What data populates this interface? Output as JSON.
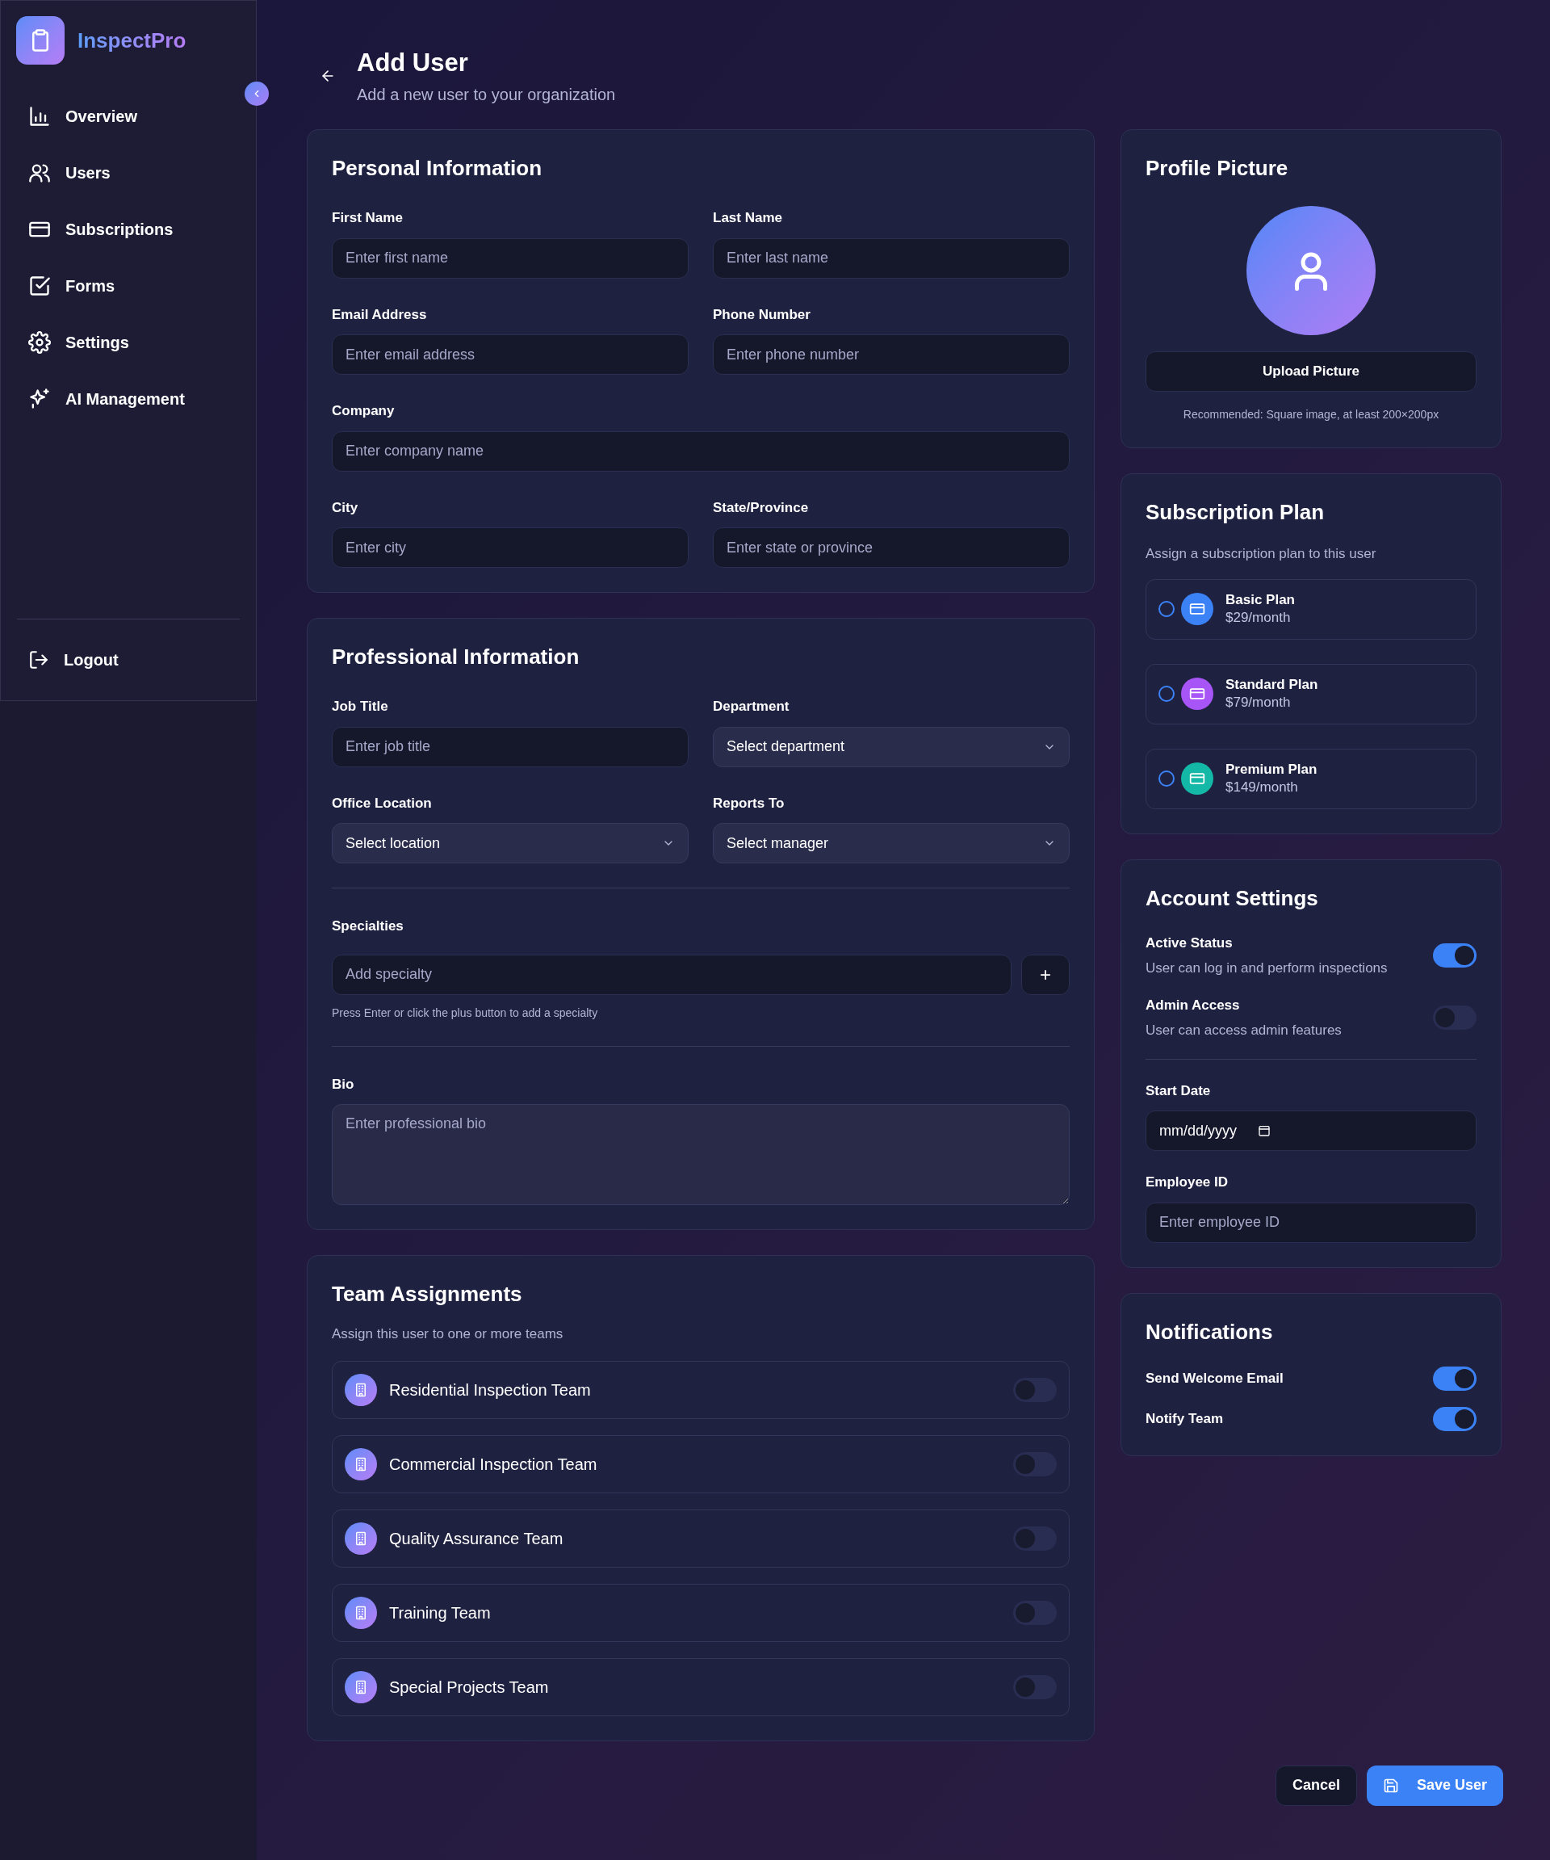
{
  "sidebar": {
    "brand": "InspectPro",
    "items": [
      {
        "label": "Overview",
        "selected": false
      },
      {
        "label": "Users",
        "selected": false
      },
      {
        "label": "Subscriptions",
        "selected": false
      },
      {
        "label": "Forms",
        "selected": false
      },
      {
        "label": "Settings",
        "selected": false
      },
      {
        "label": "AI Management",
        "selected": false
      }
    ],
    "logout": "Logout"
  },
  "header": {
    "title": "Add User",
    "subtitle": "Add a new user to your organization"
  },
  "personal": {
    "title": "Personal Information",
    "fields": [
      {
        "label": "First Name",
        "placeholder": "Enter first name",
        "kind": "input"
      },
      {
        "label": "Last Name",
        "placeholder": "Enter last name",
        "kind": "input"
      },
      {
        "label": "Email Address",
        "placeholder": "Enter email address",
        "kind": "input"
      },
      {
        "label": "Phone Number",
        "placeholder": "Enter phone number",
        "kind": "input"
      },
      {
        "label": "Company",
        "placeholder": "Enter company name",
        "kind": "input",
        "wide": true
      },
      {
        "label": "City",
        "placeholder": "Enter city",
        "kind": "input"
      },
      {
        "label": "State/Province",
        "placeholder": "Enter state or province",
        "kind": "input"
      }
    ]
  },
  "professional": {
    "title": "Professional Information",
    "fields": [
      {
        "label": "Job Title",
        "placeholder": "Enter job title",
        "kind": "input"
      },
      {
        "label": "Department",
        "value": "Select department",
        "kind": "select"
      },
      {
        "label": "Office Location",
        "value": "Select location",
        "kind": "select"
      },
      {
        "label": "Reports To",
        "value": "Select manager",
        "kind": "select"
      }
    ],
    "specialties": {
      "label": "Specialties",
      "placeholder": "Add specialty",
      "add_button": "+",
      "hint": "Press Enter or click the plus button to add a specialty"
    },
    "bio": {
      "label": "Bio",
      "placeholder": "Enter professional bio"
    }
  },
  "team": {
    "title": "Team Assignments",
    "subtitle": "Assign this user to one or more teams",
    "teams": [
      {
        "name": "Residential Inspection Team",
        "on": false
      },
      {
        "name": "Commercial Inspection Team",
        "on": false
      },
      {
        "name": "Quality Assurance Team",
        "on": false
      },
      {
        "name": "Training Team",
        "on": false
      },
      {
        "name": "Special Projects Team",
        "on": false
      }
    ]
  },
  "profile": {
    "title": "Profile Picture",
    "button": "Upload Picture",
    "hint": "Recommended: Square image, at least 200×200px"
  },
  "subscription": {
    "title": "Subscription Plan",
    "subtitle": "Assign a subscription plan to this user",
    "plans": [
      {
        "name": "Basic Plan",
        "price": "$29/month",
        "color": "#3b82f6",
        "selected": false
      },
      {
        "name": "Standard Plan",
        "price": "$79/month",
        "color": "#a855f7",
        "selected": false
      },
      {
        "name": "Premium Plan",
        "price": "$149/month",
        "color": "#14b8a6",
        "selected": false
      }
    ]
  },
  "account": {
    "title": "Account Settings",
    "toggles": [
      {
        "label": "Active Status",
        "description": "User can log in and perform inspections",
        "on": true
      },
      {
        "label": "Admin Access",
        "description": "User can access admin features",
        "on": false
      }
    ],
    "start_date": {
      "label": "Start Date",
      "value": "mm/dd/yyyy"
    },
    "employee_id": {
      "label": "Employee ID",
      "placeholder": "Enter employee ID"
    }
  },
  "notifications": {
    "title": "Notifications",
    "toggles": [
      {
        "label": "Send Welcome Email",
        "on": true
      },
      {
        "label": "Notify Team",
        "on": true
      }
    ]
  },
  "actions": {
    "cancel": "Cancel",
    "save": "Save User"
  }
}
